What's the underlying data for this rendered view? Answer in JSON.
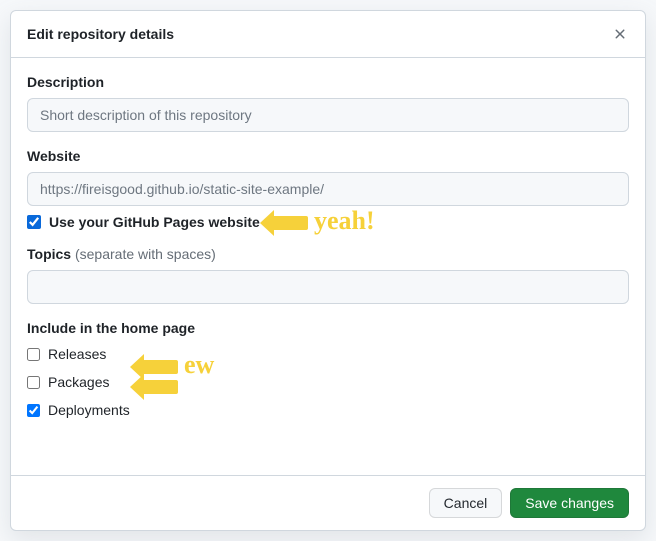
{
  "modal": {
    "title": "Edit repository details"
  },
  "form": {
    "description": {
      "label": "Description",
      "placeholder": "Short description of this repository",
      "value": ""
    },
    "website": {
      "label": "Website",
      "value": "https://fireisgood.github.io/static-site-example/"
    },
    "use_github_pages": {
      "label": "Use your GitHub Pages website",
      "checked": true
    },
    "topics": {
      "label": "Topics",
      "hint": "(separate with spaces)",
      "value": ""
    }
  },
  "include": {
    "heading": "Include in the home page",
    "releases": {
      "label": "Releases",
      "checked": false
    },
    "packages": {
      "label": "Packages",
      "checked": false
    },
    "deployments": {
      "label": "Deployments",
      "checked": true
    }
  },
  "footer": {
    "cancel": "Cancel",
    "save": "Save changes"
  },
  "annotations": {
    "yeah": "yeah!",
    "ew": "ew"
  }
}
